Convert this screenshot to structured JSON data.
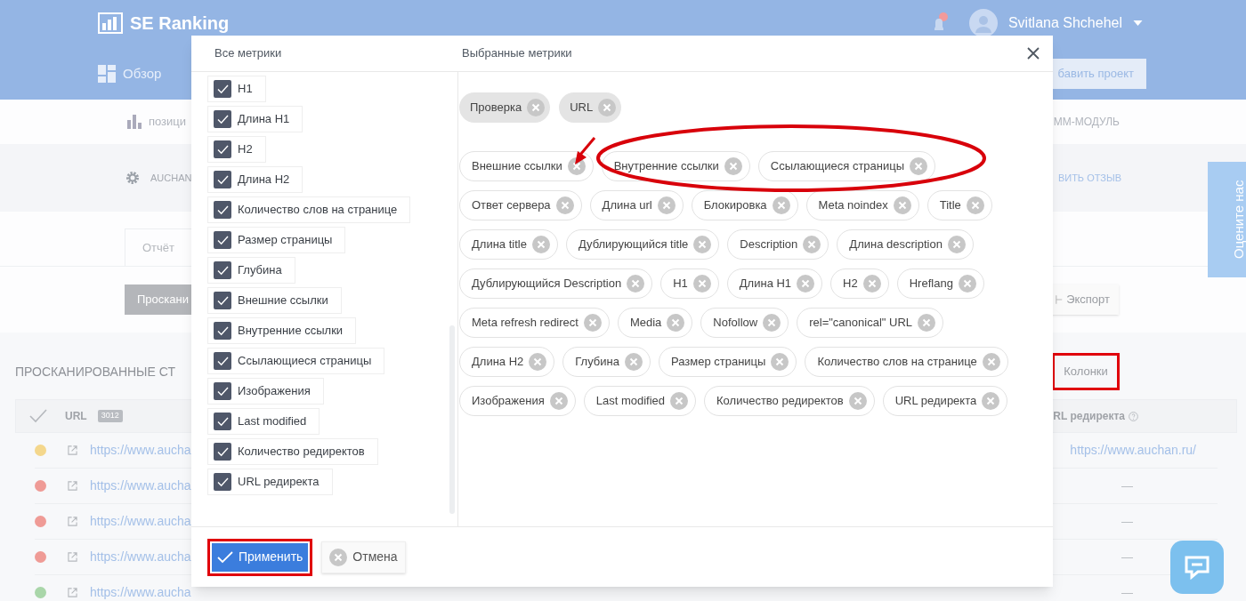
{
  "header": {
    "logo": "SE Ranking",
    "nav": "Обзор",
    "user": "Svitlana Shchehel",
    "add_project": "бавить проект"
  },
  "subnav": {
    "left": "позици",
    "right": "ММ-МОДУЛЬ"
  },
  "project_bar": {
    "project": "AUCHAN",
    "feedback": "ВИТЬ ОТЗЫВ"
  },
  "report_tab": "Отчёт",
  "toolbar": {
    "scan_button": "Проскани",
    "export_button": "Экспорт"
  },
  "section": {
    "title": "ПРОСКАНИРОВАННЫЕ СТ",
    "columns_button": "Колонки"
  },
  "table": {
    "columns": [
      {
        "label": "URL",
        "badge": "3012"
      },
      {
        "label": "RL редиректа"
      }
    ],
    "rows": [
      {
        "color": "#f4d78c",
        "url": "https://www.aucha",
        "redirect": "https://www.auchan.ru/"
      },
      {
        "color": "#ef9b96",
        "url": "https://www.aucha",
        "redirect": "—"
      },
      {
        "color": "#ef9b96",
        "url": "https://www.aucha",
        "redirect": "—"
      },
      {
        "color": "#ef9b96",
        "url": "https://www.aucha",
        "redirect": "—"
      },
      {
        "color": "#a9d6a9",
        "url": "https://www.aucha",
        "redirect": "—"
      }
    ]
  },
  "rate_tab": "Оцените нас",
  "modal": {
    "all_title": "Все метрики",
    "selected_title": "Выбранные метрики",
    "all_metrics": [
      {
        "label": "H1",
        "checked": true
      },
      {
        "label": "Длина H1",
        "checked": true
      },
      {
        "label": "H2",
        "checked": true
      },
      {
        "label": "Длина H2",
        "checked": true
      },
      {
        "label": "Количество слов на странице",
        "checked": true
      },
      {
        "label": "Размер страницы",
        "checked": true
      },
      {
        "label": "Глубина",
        "checked": true
      },
      {
        "label": "Внешние ссылки",
        "checked": true
      },
      {
        "label": "Внутренние ссылки",
        "checked": true
      },
      {
        "label": "Ссылающиеся страницы",
        "checked": true
      },
      {
        "label": "Изображения",
        "checked": true
      },
      {
        "label": "Last modified",
        "checked": true
      },
      {
        "label": "Количество редиректов",
        "checked": true
      },
      {
        "label": "URL редиректа",
        "checked": true
      }
    ],
    "fixed_metrics": [
      "Проверка",
      "URL"
    ],
    "selected_metrics": [
      "Внешние ссылки",
      "Внутренние ссылки",
      "Ссылающиеся страницы",
      "Ответ сервера",
      "Длина url",
      "Блокировка",
      "Meta noindex",
      "Title",
      "Длина title",
      "Дублирующийся title",
      "Description",
      "Длина description",
      "Дублирующийся Description",
      "H1",
      "Длина H1",
      "H2",
      "Hreflang",
      "Meta refresh redirect",
      "Media",
      "Nofollow",
      "rel=\"canonical\" URL",
      "Длина H2",
      "Глубина",
      "Размер страницы",
      "Количество слов на странице",
      "Изображения",
      "Last modified",
      "Количество редиректов",
      "URL редиректа"
    ],
    "apply": "Применить",
    "cancel": "Отмена"
  }
}
